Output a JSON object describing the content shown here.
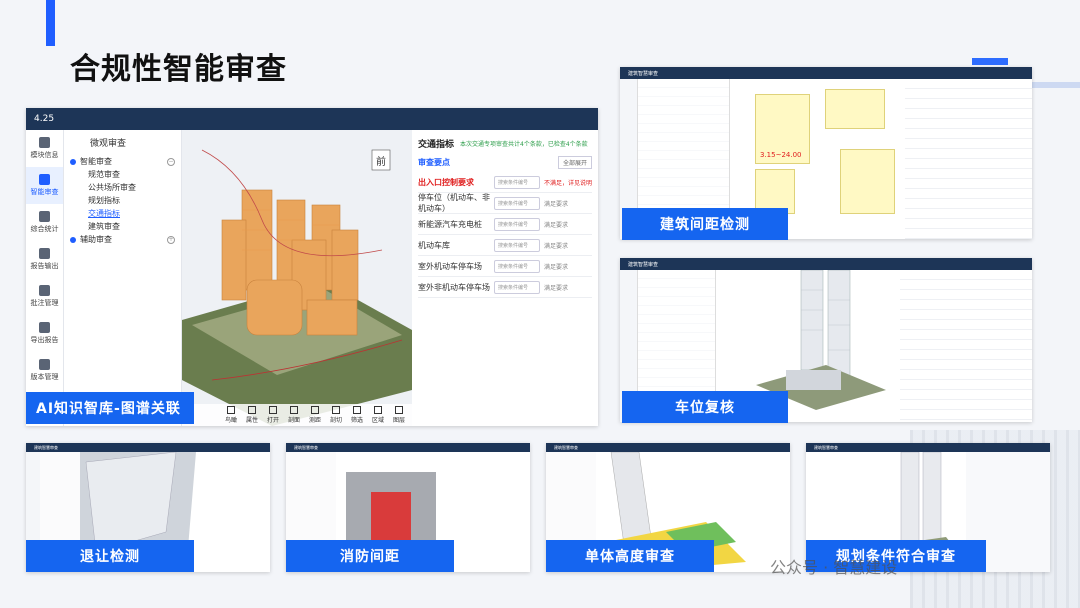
{
  "slide": {
    "title": "合规性智能审查",
    "watermark": "公众号 · 智慧建设",
    "accent": "#1f5eff",
    "caption_color": "#1565f0"
  },
  "main_app": {
    "version": "4.25",
    "nav": [
      {
        "label": "模块信息"
      },
      {
        "label": "智能审查",
        "active": true
      },
      {
        "label": "综合统计"
      },
      {
        "label": "报告输出"
      },
      {
        "label": "批注管理"
      },
      {
        "label": "导出报告"
      },
      {
        "label": "版本管理"
      }
    ],
    "tree": {
      "header": "微观审查",
      "groups": [
        {
          "label": "智能审查",
          "items": [
            "规范审查",
            "公共场所审查",
            "规划指标",
            "交通指标",
            "建筑审查"
          ],
          "active_item": "交通指标"
        },
        {
          "label": "辅助审查",
          "items": []
        }
      ]
    },
    "toolbar": [
      "鸟瞰",
      "属性",
      "打开",
      "剖面",
      "测距",
      "剖切",
      "筛选",
      "区域",
      "图层"
    ],
    "check": {
      "tab": "交通指标",
      "note": "本次交通专项审查共计4个条款，已检查4个条款",
      "header": "审查要点",
      "expand": "全部展开",
      "search_placeholder": "搜索条件编号",
      "rows": [
        {
          "label": "出入口控制要求",
          "status": "不满足，详见说明",
          "red": true
        },
        {
          "label": "停车位（机动车、非机动车）",
          "status": "满足要求"
        },
        {
          "label": "新能源汽车充电桩",
          "status": "满足要求"
        },
        {
          "label": "机动车库",
          "status": "满足要求"
        },
        {
          "label": "室外机动车停车场",
          "status": "满足要求"
        },
        {
          "label": "室外非机动车停车场",
          "status": "满足要求"
        }
      ]
    }
  },
  "captions": {
    "main": "AI知识智库-图谱关联",
    "spacing": "建筑间距检测",
    "parking": "车位复核",
    "setback": "退让检测",
    "fire": "消防间距",
    "height": "单体高度审查",
    "planning": "规划条件符合审查"
  },
  "thumb_top": {
    "spacing_label": "3.15~24.00"
  },
  "thumb_bar_title": "建筑智慧审查"
}
